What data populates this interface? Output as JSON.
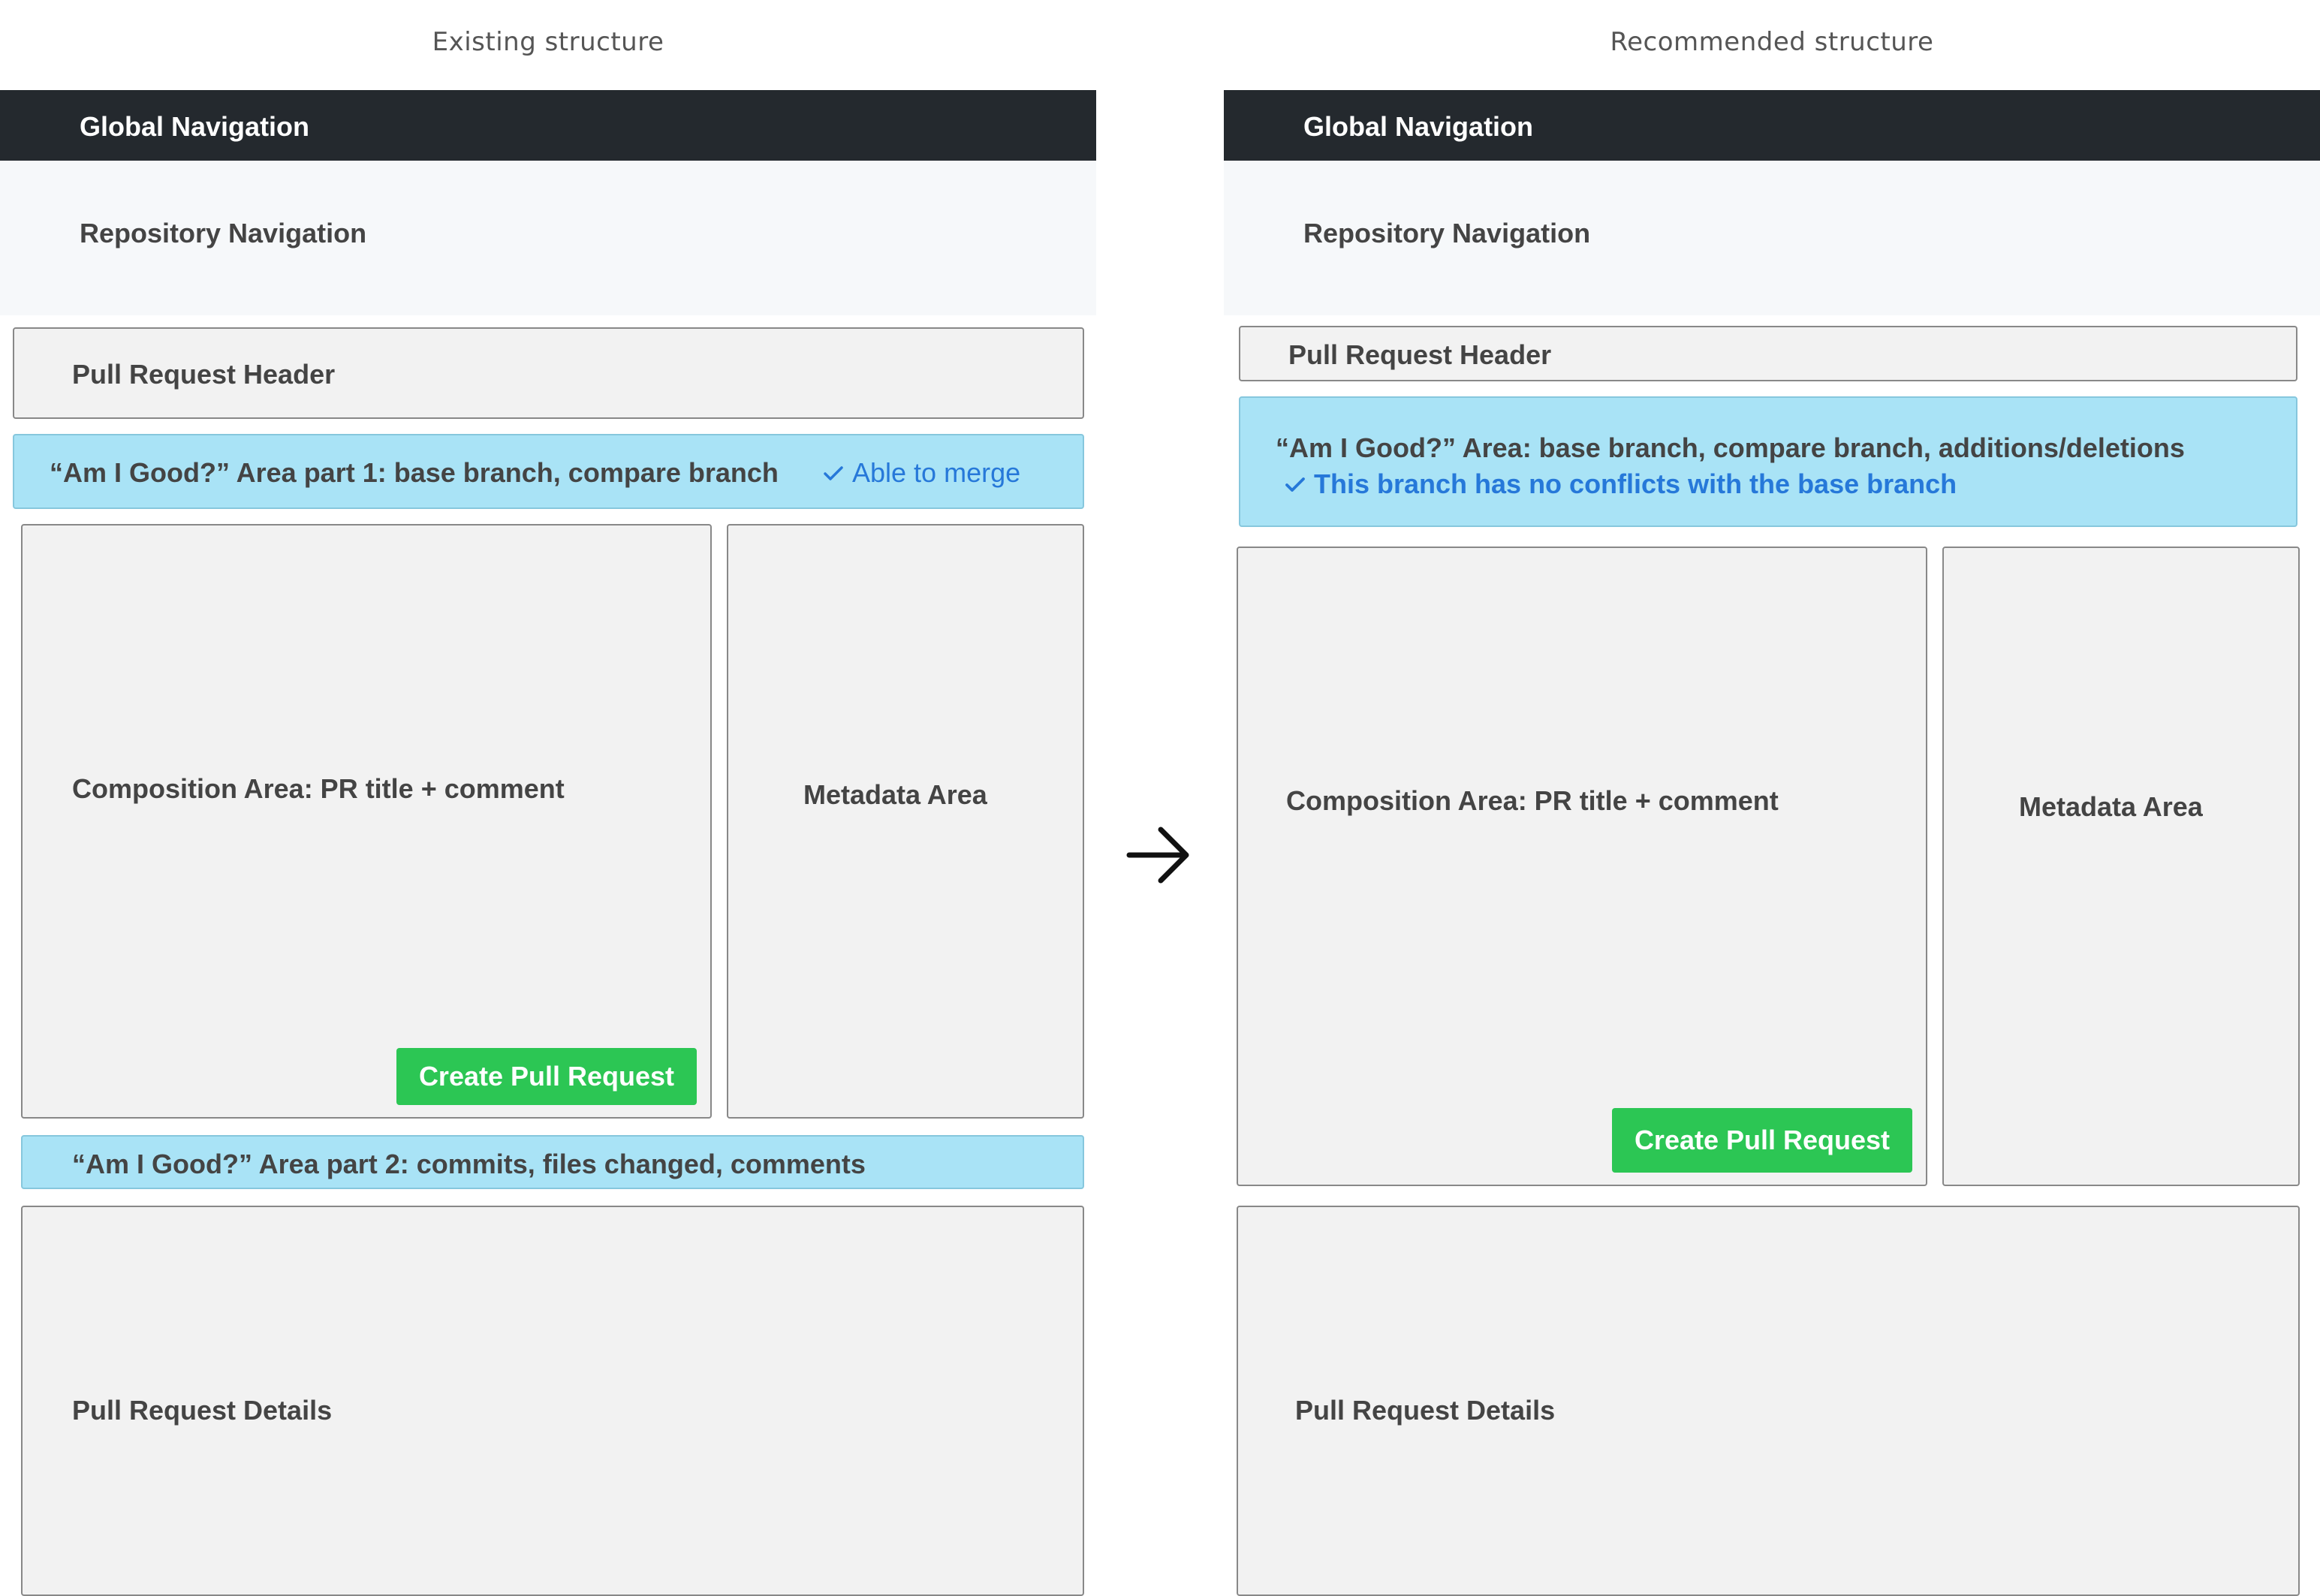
{
  "left": {
    "caption": "Existing structure",
    "global_nav": "Global Navigation",
    "repo_nav": "Repository Navigation",
    "pr_header": "Pull Request Header",
    "am_i_good_1": "“Am I Good?” Area part 1: base branch, compare branch",
    "merge_status": "Able to merge",
    "composition": "Composition Area: PR title + comment",
    "create_button": "Create Pull Request",
    "metadata": "Metadata Area",
    "am_i_good_2": "“Am I Good?” Area part 2: commits, files changed, comments",
    "details": "Pull Request Details"
  },
  "right": {
    "caption": "Recommended structure",
    "global_nav": "Global Navigation",
    "repo_nav": "Repository Navigation",
    "pr_header": "Pull Request Header",
    "am_i_good": "“Am I Good?” Area: base branch, compare branch, additions/deletions",
    "merge_status": "This branch has no conflicts with the base branch",
    "composition": "Composition Area: PR title + comment",
    "create_button": "Create Pull Request",
    "metadata": "Metadata Area",
    "details": "Pull Request Details"
  },
  "icons": {
    "arrow": "arrow-right-icon",
    "check": "check-icon"
  },
  "colors": {
    "global_nav_bg": "#24292e",
    "repo_nav_bg": "#f6f8fa",
    "am_i_good_bg": "#a9e3f6",
    "box_bg": "#f2f2f2",
    "button_bg": "#2cc654",
    "link_blue": "#2678d9"
  }
}
